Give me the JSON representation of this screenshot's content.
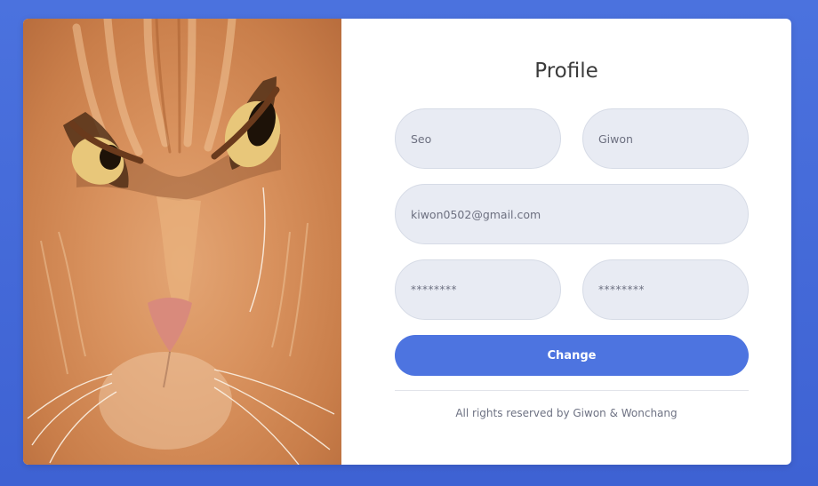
{
  "profile": {
    "title": "Profile",
    "first_name": "Seo",
    "last_name": "Giwon",
    "email": "kiwon0502@gmail.com",
    "password": "********",
    "password_confirm": "********",
    "submit_label": "Change",
    "footer": "All rights reserved by Giwon & Wonchang"
  },
  "colors": {
    "background": "#4b72de",
    "button": "#4d74e0",
    "field_bg": "#e8ebf3"
  }
}
